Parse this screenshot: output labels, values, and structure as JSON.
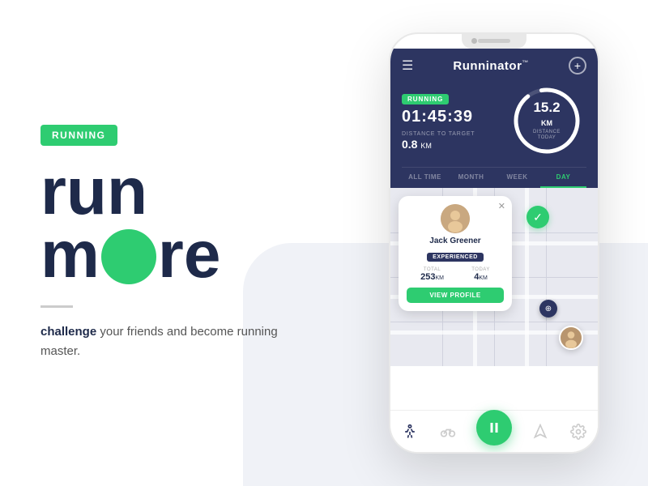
{
  "left": {
    "badge_label": "RUNNING",
    "headline_line1": "run",
    "headline_line2": "m",
    "headline_line2b": "re",
    "tagline_bold": "challenge",
    "tagline_rest": " your friends and become running master."
  },
  "app": {
    "logo": "Runninator",
    "logo_tm": "™",
    "header": {
      "running_badge": "RUNNING",
      "timer": "01:45:39",
      "distance_to_target_label": "DISTANCE TO TARGET",
      "distance_to_target_value": "0.8",
      "distance_unit": "KM",
      "circle_km": "15.2 KM",
      "circle_label": "DISTANCE TODAY"
    },
    "tabs": [
      {
        "label": "ALL TIME",
        "active": false
      },
      {
        "label": "MONTH",
        "active": false
      },
      {
        "label": "WEEK",
        "active": false
      },
      {
        "label": "DAY",
        "active": true
      }
    ],
    "user_card": {
      "name": "Jack Greener",
      "level": "EXPERIENCED",
      "total_label": "TOTAL",
      "total_value": "253",
      "total_unit": "KM",
      "today_label": "TODAY",
      "today_value": "4",
      "today_unit": "KM",
      "btn_label": "VIEW PROFILE"
    },
    "nav": {
      "icons": [
        "runner",
        "cyclist",
        "pause",
        "directions",
        "settings"
      ]
    }
  }
}
